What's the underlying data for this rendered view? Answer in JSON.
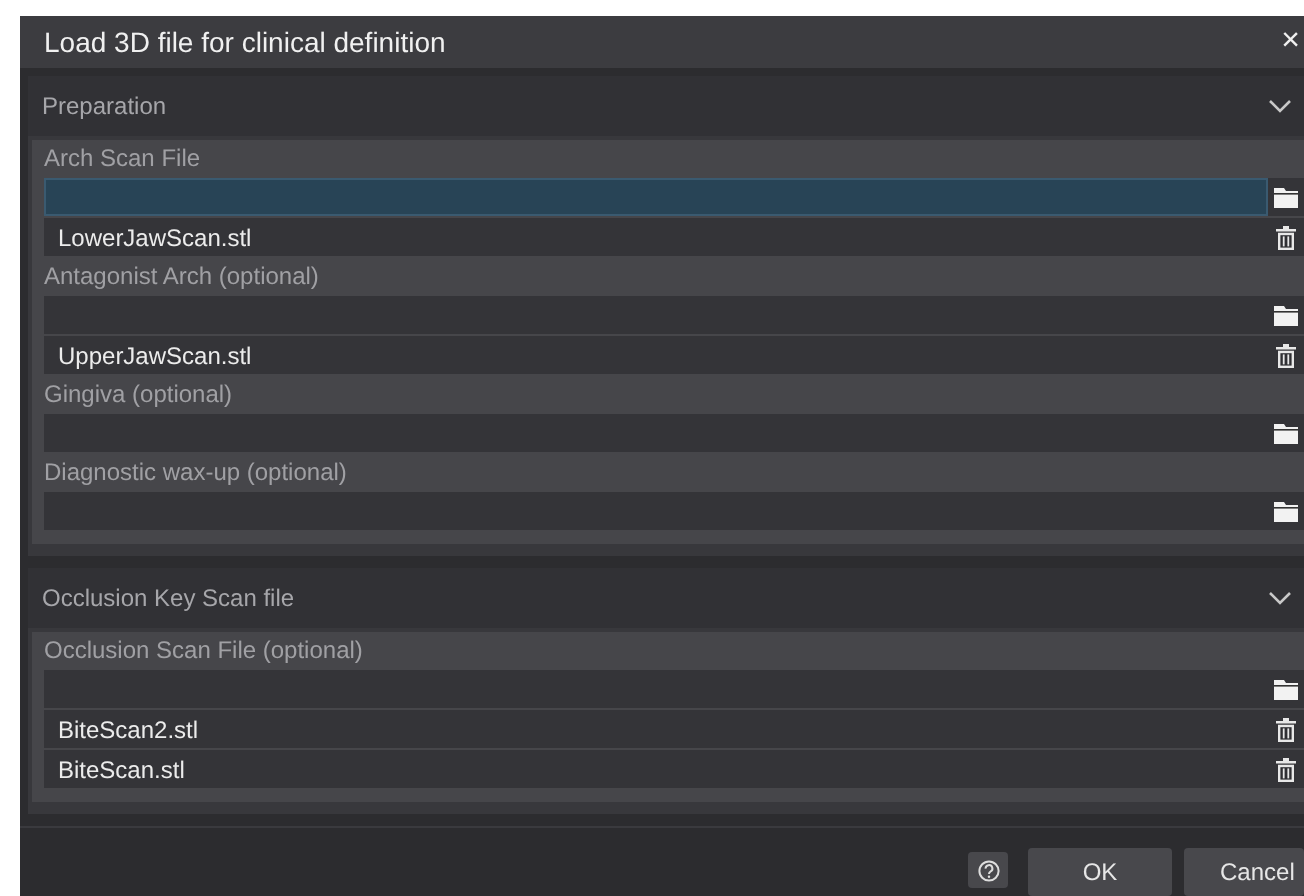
{
  "window": {
    "title": "Load 3D file for clinical definition",
    "close": "×"
  },
  "sections": [
    {
      "title": "Preparation",
      "expanded": true,
      "groups": [
        {
          "label": "Arch Scan File",
          "field_selected": true,
          "files": [
            "LowerJawScan.stl"
          ]
        },
        {
          "label": "Antagonist Arch (optional)",
          "field_selected": false,
          "files": [
            "UpperJawScan.stl"
          ]
        },
        {
          "label": "Gingiva (optional)",
          "field_selected": false
        },
        {
          "label": "Diagnostic wax-up (optional)",
          "field_selected": false
        }
      ]
    },
    {
      "title": "Occlusion Key Scan file",
      "expanded": true,
      "groups": [
        {
          "label": "Occlusion Scan File (optional)",
          "field_selected": false,
          "files": [
            "BiteScan2.stl",
            "BiteScan.stl"
          ]
        }
      ]
    }
  ],
  "buttons": [
    {
      "kind": "help"
    },
    {
      "kind": "text",
      "label": "OK"
    },
    {
      "kind": "text",
      "label": "Cancel"
    }
  ]
}
